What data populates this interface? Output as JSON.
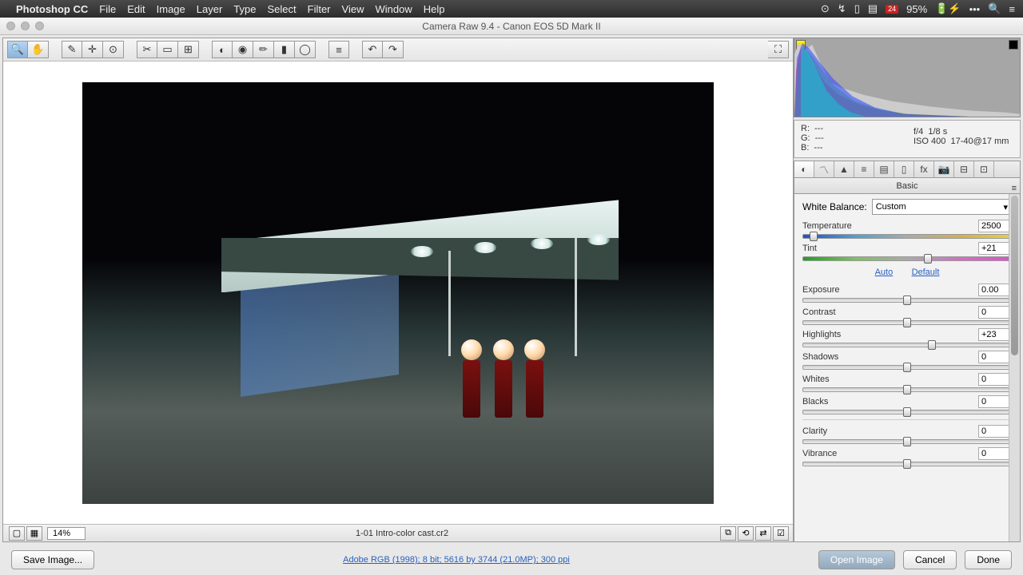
{
  "menubar": {
    "app": "Photoshop CC",
    "items": [
      "File",
      "Edit",
      "Image",
      "Layer",
      "Type",
      "Select",
      "Filter",
      "View",
      "Window",
      "Help"
    ],
    "calendar_day": "24",
    "battery": "95%"
  },
  "window": {
    "title": "Camera Raw 9.4  -  Canon EOS 5D Mark II"
  },
  "toolbar": {
    "tools": [
      {
        "name": "zoom-tool",
        "glyph": "🔍"
      },
      {
        "name": "hand-tool",
        "glyph": "✋"
      },
      {
        "name": "white-balance-tool",
        "glyph": "✎"
      },
      {
        "name": "color-sampler-tool",
        "glyph": "✛"
      },
      {
        "name": "targeted-adjustment-tool",
        "glyph": "⊙"
      },
      {
        "name": "crop-tool",
        "glyph": "✂"
      },
      {
        "name": "straighten-tool",
        "glyph": "▭"
      },
      {
        "name": "transform-tool",
        "glyph": "⊞"
      },
      {
        "name": "spot-removal-tool",
        "glyph": "◐"
      },
      {
        "name": "red-eye-tool",
        "glyph": "◉"
      },
      {
        "name": "adjustment-brush-tool",
        "glyph": "✏"
      },
      {
        "name": "graduated-filter-tool",
        "glyph": "▮"
      },
      {
        "name": "radial-filter-tool",
        "glyph": "◯"
      },
      {
        "name": "preferences-tool",
        "glyph": "≡"
      },
      {
        "name": "rotate-ccw-tool",
        "glyph": "↶"
      },
      {
        "name": "rotate-cw-tool",
        "glyph": "↷"
      }
    ],
    "fullscreen_glyph": "⛶"
  },
  "preview": {
    "zoom": "14%",
    "filename": "1-01 Intro-color cast.cr2"
  },
  "info": {
    "r": "---",
    "g": "---",
    "b": "---",
    "aperture": "f/4",
    "shutter": "1/8 s",
    "iso": "ISO 400",
    "lens": "17-40@17 mm"
  },
  "panel": {
    "title": "Basic",
    "wb_label": "White Balance:",
    "wb_value": "Custom",
    "auto": "Auto",
    "default": "Default",
    "sliders": {
      "temperature": {
        "label": "Temperature",
        "value": "2500",
        "pos": 5
      },
      "tint": {
        "label": "Tint",
        "value": "+21",
        "pos": 60
      },
      "exposure": {
        "label": "Exposure",
        "value": "0.00",
        "pos": 50
      },
      "contrast": {
        "label": "Contrast",
        "value": "0",
        "pos": 50
      },
      "highlights": {
        "label": "Highlights",
        "value": "+23",
        "pos": 62
      },
      "shadows": {
        "label": "Shadows",
        "value": "0",
        "pos": 50
      },
      "whites": {
        "label": "Whites",
        "value": "0",
        "pos": 50
      },
      "blacks": {
        "label": "Blacks",
        "value": "0",
        "pos": 50
      },
      "clarity": {
        "label": "Clarity",
        "value": "0",
        "pos": 50
      },
      "vibrance": {
        "label": "Vibrance",
        "value": "0",
        "pos": 50
      }
    }
  },
  "footer": {
    "save": "Save Image...",
    "workflow": "Adobe RGB (1998); 8 bit; 5616 by 3744 (21.0MP); 300 ppi",
    "open": "Open Image",
    "cancel": "Cancel",
    "done": "Done"
  }
}
